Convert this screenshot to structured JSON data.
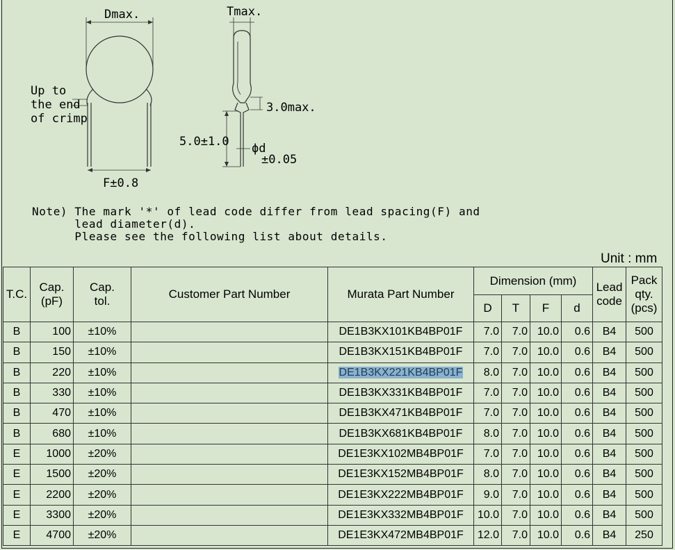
{
  "drawing": {
    "dmax": "Dmax.",
    "tmax": "Tmax.",
    "crimp": [
      "Up to",
      "the end",
      "of crimp"
    ],
    "crimp_max": "3.0max.",
    "lead_length": "5.0±1.0",
    "phi_d": "ϕd",
    "phi_d_tol": "±0.05",
    "f_tol": "F±0.8"
  },
  "note": "Note) The mark '*' of lead code differ from lead spacing(F) and\n      lead diameter(d).\n      Please see the following list about details.",
  "unit": "Unit : mm",
  "table": {
    "headers": {
      "tc": "T.C.",
      "cap": "Cap.\n(pF)",
      "tol": "Cap.\ntol.",
      "customer": "Customer Part Number",
      "murata": "Murata Part Number",
      "dimension": "Dimension (mm)",
      "d": "D",
      "t": "T",
      "f": "F",
      "dd": "d",
      "lead": "Lead\ncode",
      "pack": "Pack\nqty.\n(pcs)"
    },
    "rows": [
      {
        "tc": "B",
        "cap": "100",
        "tol": "±10%",
        "customer": "",
        "murata": "DE1B3KX101KB4BP01F",
        "D": "7.0",
        "T": "7.0",
        "F": "10.0",
        "d": "0.6",
        "lead": "B4",
        "pack": "500"
      },
      {
        "tc": "B",
        "cap": "150",
        "tol": "±10%",
        "customer": "",
        "murata": "DE1B3KX151KB4BP01F",
        "D": "7.0",
        "T": "7.0",
        "F": "10.0",
        "d": "0.6",
        "lead": "B4",
        "pack": "500"
      },
      {
        "tc": "B",
        "cap": "220",
        "tol": "±10%",
        "customer": "",
        "murata": "DE1B3KX221KB4BP01F",
        "D": "8.0",
        "T": "7.0",
        "F": "10.0",
        "d": "0.6",
        "lead": "B4",
        "pack": "500",
        "selected": true
      },
      {
        "tc": "B",
        "cap": "330",
        "tol": "±10%",
        "customer": "",
        "murata": "DE1B3KX331KB4BP01F",
        "D": "7.0",
        "T": "7.0",
        "F": "10.0",
        "d": "0.6",
        "lead": "B4",
        "pack": "500"
      },
      {
        "tc": "B",
        "cap": "470",
        "tol": "±10%",
        "customer": "",
        "murata": "DE1B3KX471KB4BP01F",
        "D": "7.0",
        "T": "7.0",
        "F": "10.0",
        "d": "0.6",
        "lead": "B4",
        "pack": "500"
      },
      {
        "tc": "B",
        "cap": "680",
        "tol": "±10%",
        "customer": "",
        "murata": "DE1B3KX681KB4BP01F",
        "D": "8.0",
        "T": "7.0",
        "F": "10.0",
        "d": "0.6",
        "lead": "B4",
        "pack": "500"
      },
      {
        "tc": "E",
        "cap": "1000",
        "tol": "±20%",
        "customer": "",
        "murata": "DE1E3KX102MB4BP01F",
        "D": "7.0",
        "T": "7.0",
        "F": "10.0",
        "d": "0.6",
        "lead": "B4",
        "pack": "500"
      },
      {
        "tc": "E",
        "cap": "1500",
        "tol": "±20%",
        "customer": "",
        "murata": "DE1E3KX152MB4BP01F",
        "D": "8.0",
        "T": "7.0",
        "F": "10.0",
        "d": "0.6",
        "lead": "B4",
        "pack": "500"
      },
      {
        "tc": "E",
        "cap": "2200",
        "tol": "±20%",
        "customer": "",
        "murata": "DE1E3KX222MB4BP01F",
        "D": "9.0",
        "T": "7.0",
        "F": "10.0",
        "d": "0.6",
        "lead": "B4",
        "pack": "500"
      },
      {
        "tc": "E",
        "cap": "3300",
        "tol": "±20%",
        "customer": "",
        "murata": "DE1E3KX332MB4BP01F",
        "D": "10.0",
        "T": "7.0",
        "F": "10.0",
        "d": "0.6",
        "lead": "B4",
        "pack": "500"
      },
      {
        "tc": "E",
        "cap": "4700",
        "tol": "±20%",
        "customer": "",
        "murata": "DE1E3KX472MB4BP01F",
        "D": "12.0",
        "T": "7.0",
        "F": "10.0",
        "d": "0.6",
        "lead": "B4",
        "pack": "250"
      }
    ]
  },
  "colors": {
    "background": "#d8e6cf",
    "selection": "#8ab2cf"
  }
}
